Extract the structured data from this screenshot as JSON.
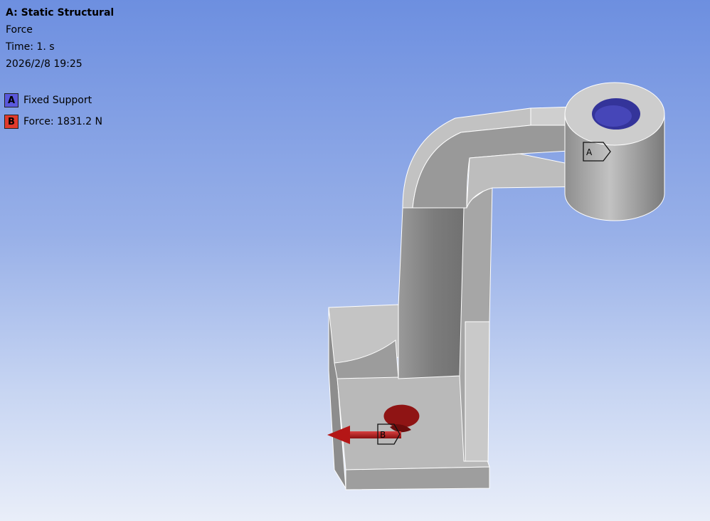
{
  "header": {
    "title": "A: Static Structural",
    "subtitle": "Force",
    "time": "Time: 1. s",
    "date": "2026/2/8 19:25"
  },
  "legend": {
    "items": [
      {
        "tag": "A",
        "label": "Fixed Support",
        "color": "#5a58dc"
      },
      {
        "tag": "B",
        "label": "Force: 1831.2 N",
        "color": "#e03a2c"
      }
    ]
  },
  "model": {
    "tag_a": "A",
    "tag_b": "B",
    "colors": {
      "body": "#b4b4b4",
      "face_light": "#d6d6d6",
      "face_dark": "#8a8a8a",
      "hole_blue": "#3a3aa8",
      "hole_red": "#a01818",
      "arrow": "#b81818"
    }
  }
}
